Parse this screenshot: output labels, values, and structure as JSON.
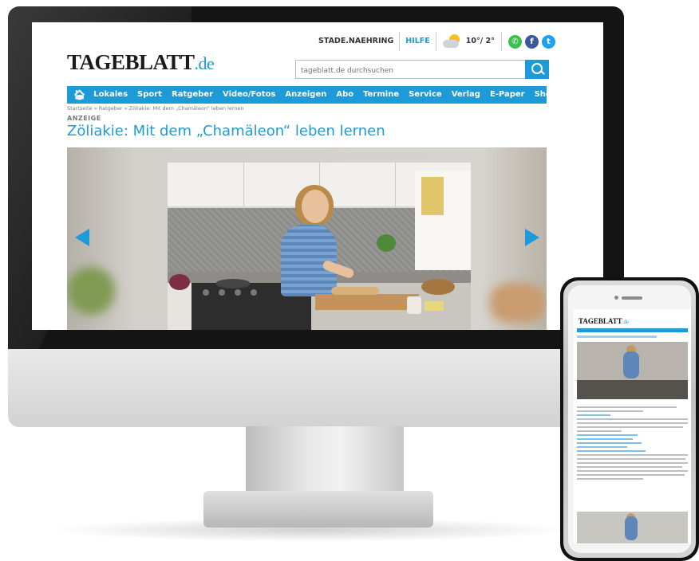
{
  "site": {
    "logo_main": "TAGEBLATT",
    "logo_tld": ".de",
    "top_links": {
      "location": "STADE.NAEHRING",
      "help": "HILFE"
    },
    "weather": {
      "temperature": "10°/ 2°",
      "icon": "partly-cloudy-icon"
    },
    "social": [
      {
        "name": "whatsapp-icon",
        "glyph": "✆",
        "color": "#3cbf4c"
      },
      {
        "name": "facebook-icon",
        "glyph": "f",
        "color": "#3b5998"
      },
      {
        "name": "twitter-icon",
        "glyph": "t",
        "color": "#1da1f2"
      }
    ],
    "search_placeholder": "tageblatt.de durchsuchen",
    "nav": [
      "Lokales",
      "Sport",
      "Ratgeber",
      "Video/Fotos",
      "Anzeigen",
      "Abo",
      "Termine",
      "Service",
      "Verlag",
      "E-Paper",
      "Shop"
    ],
    "breadcrumb": "Startseite » Ratgeber » Zöliakie: Mit dem „Chamäleon“ leben lernen",
    "kicker": "ANZEIGE",
    "headline": "Zöliakie: Mit dem „Chamäleon“ leben lernen",
    "accent_color": "#1d9bd8"
  },
  "phone": {
    "logo_main": "TAGEBLATT",
    "logo_tld": ".de"
  }
}
